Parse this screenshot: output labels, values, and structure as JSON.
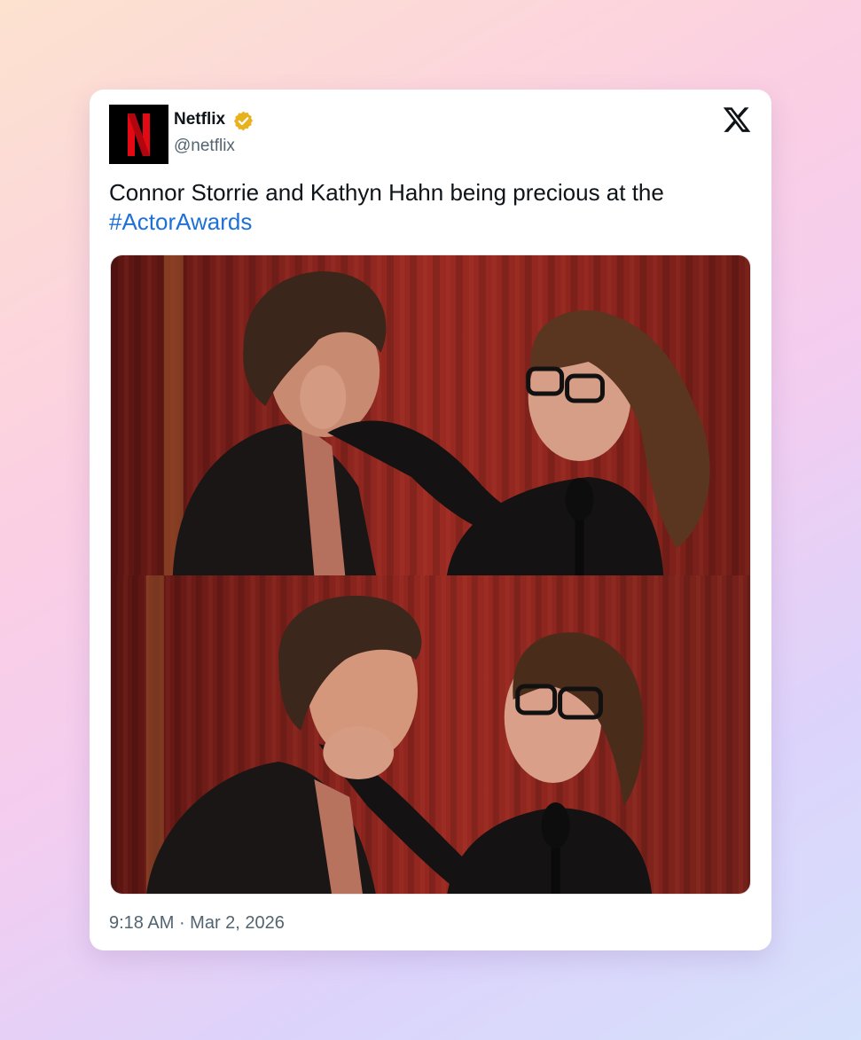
{
  "account": {
    "display_name": "Netflix",
    "handle": "@netflix",
    "avatar_letter": "N",
    "brand_color": "#e50914",
    "verified_color": "#e8b21e"
  },
  "platform": {
    "icon": "x-logo-icon"
  },
  "tweet": {
    "text": "Connor Storrie and Kathyn Hahn being precious at the",
    "hashtag": "#ActorAwards",
    "hashtag_color": "#1d71d6"
  },
  "media": {
    "images": [
      {
        "kind": "photo-still"
      },
      {
        "kind": "photo-still"
      }
    ]
  },
  "footer": {
    "time": "9:18 AM",
    "separator": " · ",
    "date": "Mar 2, 2026"
  }
}
